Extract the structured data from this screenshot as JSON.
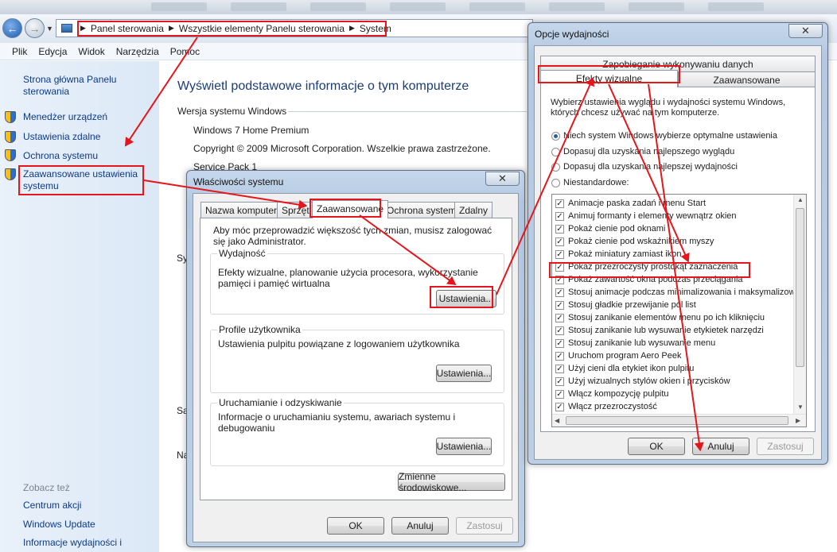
{
  "breadcrumb": {
    "items": [
      "Panel sterowania",
      "Wszystkie elementy Panelu sterowania",
      "System"
    ]
  },
  "menu": {
    "items": [
      "Plik",
      "Edycja",
      "Widok",
      "Narzędzia",
      "Pomoc"
    ]
  },
  "sidebar": {
    "home": "Strona główna Panelu sterowania",
    "links": [
      "Menedżer urządzeń",
      "Ustawienia zdalne",
      "Ochrona systemu",
      "Zaawansowane ustawienia systemu"
    ],
    "see_also_title": "Zobacz też",
    "see_also": [
      "Centrum akcji",
      "Windows Update",
      "Informacje wydajności i"
    ]
  },
  "main": {
    "title": "Wyświetl podstawowe informacje o tym komputerze",
    "section": "Wersja systemu Windows",
    "edition": "Windows 7 Home Premium",
    "copyright": "Copyright © 2009 Microsoft Corporation. Wszelkie prawa zastrzeżone.",
    "service_pack": "Service Pack 1",
    "cut_labels": [
      "Sy",
      "Sa",
      "Na"
    ]
  },
  "sysprops": {
    "title": "Właściwości systemu",
    "close": "✕",
    "tabs": [
      "Nazwa komputera",
      "Sprzęt",
      "Zaawansowane",
      "Ochrona systemu",
      "Zdalny"
    ],
    "active_tab": "Zaawansowane",
    "admin_note": "Aby móc przeprowadzić większość tych zmian, musisz zalogować się jako Administrator.",
    "perf_title": "Wydajność",
    "perf_desc": "Efekty wizualne, planowanie użycia procesora, wykorzystanie pamięci i pamięć wirtualna",
    "profiles_title": "Profile użytkownika",
    "profiles_desc": "Ustawienia pulpitu powiązane z logowaniem użytkownika",
    "startup_title": "Uruchamianie i odzyskiwanie",
    "startup_desc": "Informacje o uruchamianiu systemu, awariach systemu i debugowaniu",
    "settings_button": "Ustawienia...",
    "env_button": "Zmienne środowiskowe...",
    "ok": "OK",
    "cancel": "Anuluj",
    "apply": "Zastosuj"
  },
  "perfopts": {
    "title": "Opcje wydajności",
    "close": "✕",
    "tabs": [
      "Zapobieganie wykonywaniu danych",
      "Efekty wizualne",
      "Zaawansowane"
    ],
    "active_tab": "Efekty wizualne",
    "description": "Wybierz ustawienia wyglądu i wydajności systemu Windows, których chcesz używać na tym komputerze.",
    "radios": [
      {
        "label": "Niech system Windows wybierze optymalne ustawienia",
        "checked": true
      },
      {
        "label": "Dopasuj dla uzyskania najlepszego wyglądu",
        "checked": false
      },
      {
        "label": "Dopasuj dla uzyskania najlepszej wydajności",
        "checked": false
      },
      {
        "label": "Niestandardowe:",
        "checked": false
      }
    ],
    "effects": [
      "Animacje paska zadań i menu Start",
      "Animuj formanty i elementy wewnątrz okien",
      "Pokaż cienie pod oknami",
      "Pokaż cienie pod wskaźnikiem myszy",
      "Pokaż miniatury zamiast ikon",
      "Pokaż przezroczysty prostokąt zaznaczenia",
      "Pokaż zawartość okna podczas przeciągania",
      "Stosuj animacje podczas minimalizowania i maksymalizowania",
      "Stosuj gładkie przewijanie pól list",
      "Stosuj zanikanie elementów menu po ich kliknięciu",
      "Stosuj zanikanie lub wysuwanie etykietek narzędzi",
      "Stosuj zanikanie lub wysuwanie menu",
      "Uruchom program Aero Peek",
      "Użyj cieni dla etykiet ikon pulpitu",
      "Użyj wizualnych stylów okien i przycisków",
      "Włącz kompozycję pulpitu",
      "Włącz przezroczystość"
    ],
    "checkmark": "✓",
    "ok": "OK",
    "cancel": "Anuluj",
    "apply": "Zastosuj"
  },
  "colors": {
    "annotation": "#e4161c",
    "link": "#0c3a8c",
    "title_blue": "#1a3d7a"
  }
}
